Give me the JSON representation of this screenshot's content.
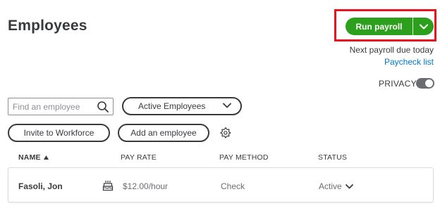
{
  "header": {
    "title": "Employees",
    "run_payroll_label": "Run payroll",
    "next_payroll_text": "Next payroll due today",
    "paycheck_list_label": "Paycheck list",
    "accent_color": "#2ca01c",
    "highlight_color": "#e8141f"
  },
  "privacy": {
    "label": "PRIVACY",
    "enabled": false
  },
  "toolbar": {
    "search_placeholder": "Find an employee",
    "search_value": "",
    "filter_selected": "Active Employees",
    "invite_label": "Invite to Workforce",
    "add_label": "Add an employee"
  },
  "table": {
    "columns": [
      "NAME",
      "PAY RATE",
      "PAY METHOD",
      "STATUS"
    ],
    "sort_column": "NAME",
    "sort_direction": "ascending",
    "rows": [
      {
        "name": "Fasoli, Jon",
        "pay_rate": "$12.00/hour",
        "pay_method": "Check",
        "status": "Active"
      }
    ]
  },
  "icons": [
    "search-icon",
    "chevron-down-icon",
    "gear-icon",
    "cake-icon",
    "sort-up-icon"
  ]
}
